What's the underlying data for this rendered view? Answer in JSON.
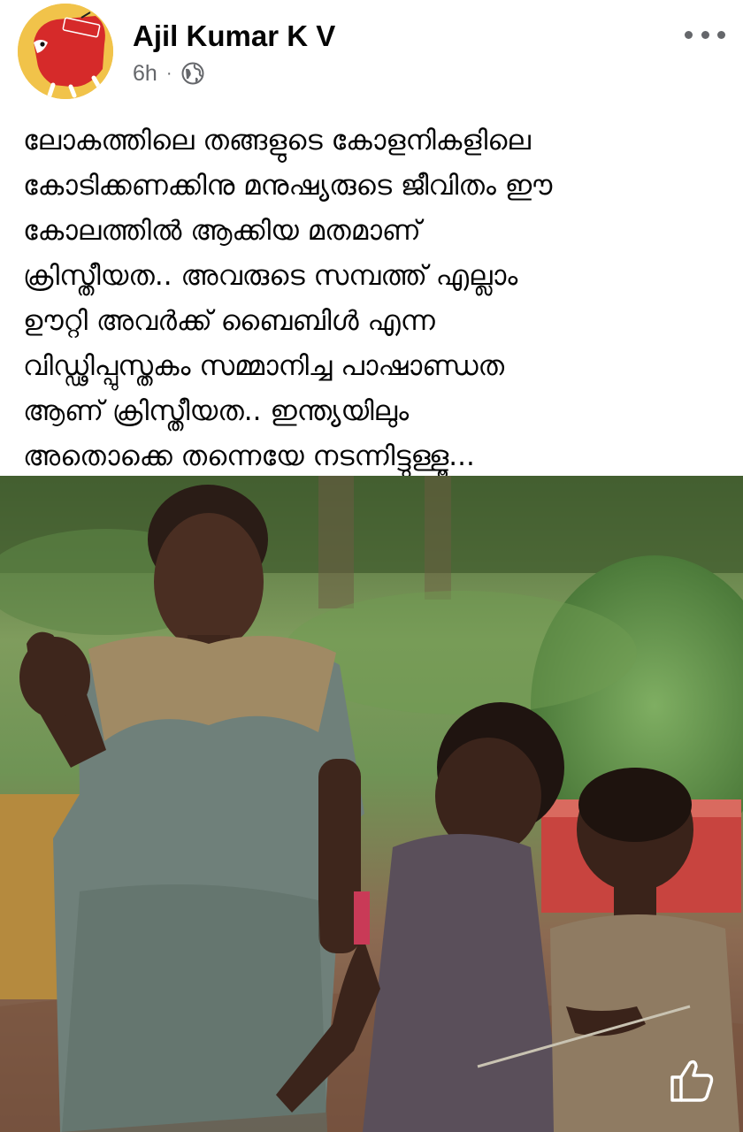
{
  "post": {
    "author": "Ajil Kumar K V",
    "time": "6h",
    "separator": "·",
    "audience_icon": "globe-icon",
    "menu_icon": "more-horizontal-icon",
    "avatar_icon": "profile-avatar",
    "text_lines": [
      "ലോകത്തിലെ തങ്ങളുടെ കോളനികളിലെ",
      "കോടിക്കണക്കിനു മനുഷ്യരുടെ ജീവിതം ഈ",
      "കോലത്തിൽ ആക്കിയ മതമാണ്",
      "ക്രിസ്തീയത.. അവരുടെ സമ്പത്ത് എല്ലാം",
      "ഊറ്റി അവർക്ക് ബൈബിൾ എന്ന",
      "വിഡ്ഢിപ്പുസ്തകം സമ്മാനിച്ച പാഷാണ്ഡത",
      "ആണ് ക്രിസ്തീയത.. ഇന്ത്യയിലും",
      "അതൊക്കെ തന്നെയേ നടന്നിട്ടുള്ളൂ..."
    ]
  },
  "photo": {
    "subject": "three-children-photo",
    "overlay_icon": "like-icon"
  },
  "colors": {
    "text_primary": "#050505",
    "text_secondary": "#65676b",
    "background": "#ffffff",
    "avatar_bg": "#f1c34a",
    "avatar_animal": "#d62a2a"
  }
}
